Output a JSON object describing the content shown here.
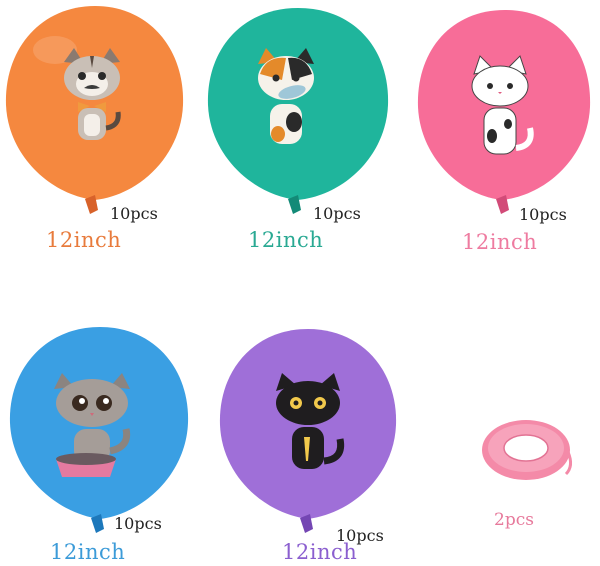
{
  "products": [
    {
      "id": "orange",
      "count": "10pcs",
      "size": "12inch",
      "balloon_color": "#f5883f",
      "size_color": "#e87b3c",
      "cat": "tabby-cat-bowtie-icon"
    },
    {
      "id": "teal",
      "count": "10pcs",
      "size": "12inch",
      "balloon_color": "#1fb59c",
      "size_color": "#2aa993",
      "cat": "calico-cat-fish-icon"
    },
    {
      "id": "pink",
      "count": "10pcs",
      "size": "12inch",
      "balloon_color": "#f76d98",
      "size_color": "#ee7ba0",
      "cat": "white-cat-icon"
    },
    {
      "id": "blue",
      "count": "10pcs",
      "size": "12inch",
      "balloon_color": "#3a9fe3",
      "size_color": "#3c9bd8",
      "cat": "gray-tabby-cat-bowl-icon"
    },
    {
      "id": "purple",
      "count": "10pcs",
      "size": "12inch",
      "balloon_color": "#9f6fd8",
      "size_color": "#8b5fcf",
      "cat": "black-cat-icon"
    }
  ],
  "ribbon": {
    "count": "2pcs",
    "color": "#f48aa8",
    "icon": "pink-ribbon-roll-icon"
  }
}
